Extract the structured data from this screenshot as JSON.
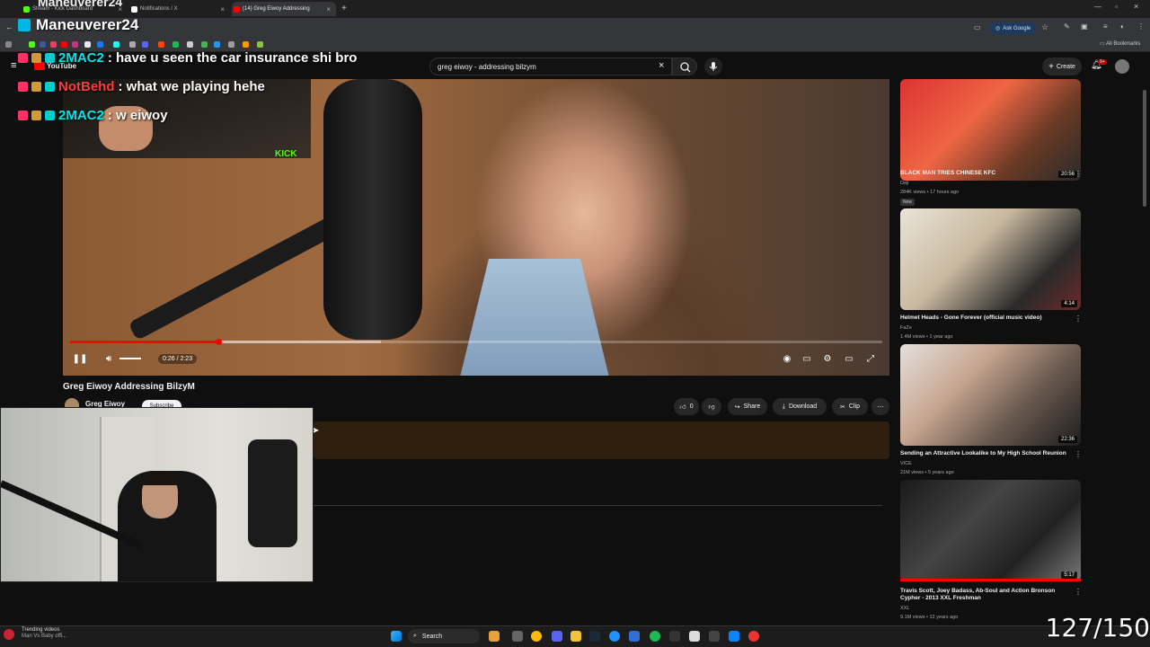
{
  "browser": {
    "tabs": [
      {
        "label": "Stream - Kick Dashboard",
        "active": false
      },
      {
        "label": "Notifications / X",
        "active": false
      },
      {
        "label": "(14) Greg Eiwoy Addressing",
        "active": true
      }
    ],
    "ask_google_label": "Ask Google",
    "all_bookmarks_label": "All Bookmarks"
  },
  "youtube": {
    "logo_text": "YouTube",
    "search_query": "greg eiwoy - addressing bilzym",
    "create_label": "Create",
    "notification_count": "9+"
  },
  "stream_overlay": {
    "streamer_name": "Maneuverer24",
    "chat": [
      {
        "user": "2MAC2",
        "message": ": have u seen the car insurance shi bro",
        "user_color": "cyan"
      },
      {
        "user": "NotBehd",
        "message": ": what we playing hehe",
        "user_color": "red"
      },
      {
        "user": "2MAC2",
        "message": ": w eiwoy",
        "user_color": "cyan"
      }
    ],
    "kick_label": "KICK",
    "counter": "127/150"
  },
  "player": {
    "time": "0:26 / 2:23",
    "progress": 0.182
  },
  "video": {
    "title": "Greg Eiwoy Addressing BilzyM",
    "channel": "Greg Eiwoy",
    "subscribe_label": "Subscribe",
    "likes": "0",
    "share_label": "Share",
    "download_label": "Download",
    "clip_label": "Clip"
  },
  "recommendations": [
    {
      "title": "BLACK MAN TRIES CHINESE KFC",
      "channel": "Deji",
      "meta": "284K views • 17 hours ago",
      "duration": "20:56",
      "badge": "New"
    },
    {
      "title": "Helmet Heads - Gone Forever (official music video)",
      "channel": "FaZe",
      "meta": "1.4M views • 1 year ago",
      "duration": "4:14"
    },
    {
      "title": "Sending an Attractive Lookalike to My High School Reunion",
      "channel": "VICE",
      "meta": "21M views • 5 years ago",
      "duration": "22:36"
    },
    {
      "title": "Travis Scott, Joey Badass, Ab-Soul and Action Bronson Cypher - 2013 XXL Freshman",
      "channel": "XXL",
      "meta": "9.1M views • 12 years ago",
      "duration": "5:17"
    }
  ],
  "taskbar": {
    "search_label": "Search",
    "trending_title": "Trending videos",
    "trending_sub": "Man Vs Baby offi..."
  }
}
